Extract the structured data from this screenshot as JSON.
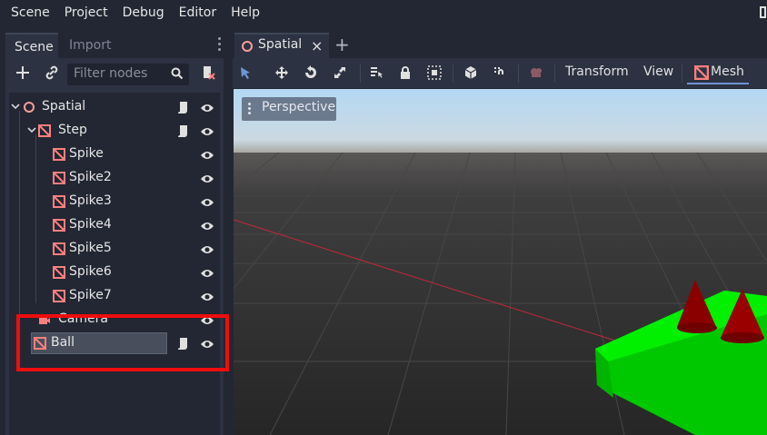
{
  "menu": [
    "Scene",
    "Project",
    "Debug",
    "Editor",
    "Help"
  ],
  "dock": {
    "tabs": {
      "scene": "Scene",
      "import": "Import"
    },
    "filter_placeholder": "Filter nodes"
  },
  "tree": {
    "spatial": "Spatial",
    "step": "Step",
    "spikes": [
      "Spike",
      "Spike2",
      "Spike3",
      "Spike4",
      "Spike5",
      "Spike6",
      "Spike7"
    ],
    "camera": "Camera",
    "ball": "Ball"
  },
  "viewport_tab": {
    "name": "Spatial",
    "close": "×",
    "add": "+"
  },
  "toolbar": {
    "transform": "Transform",
    "view": "View",
    "mesh": "Mesh"
  },
  "viewport": {
    "perspective": "Perspective"
  },
  "colors": {
    "accent": "#6f94d6",
    "mesh_icon": "#fc7f7f",
    "highlight": "#ef0d0d",
    "floor": "#00f000",
    "spike": "#8a0000"
  }
}
